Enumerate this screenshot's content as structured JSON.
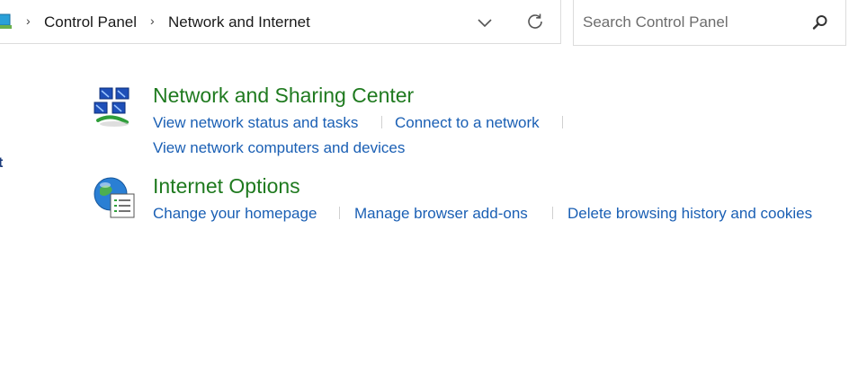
{
  "breadcrumb": {
    "items": [
      "Control Panel",
      "Network and Internet"
    ]
  },
  "search": {
    "placeholder": "Search Control Panel",
    "value": ""
  },
  "sidebar": {
    "partial_text": "t"
  },
  "categories": [
    {
      "title": "Network and Sharing Center",
      "icon": "network-icon",
      "links": [
        "View network status and tasks",
        "Connect to a network",
        "View network computers and devices"
      ]
    },
    {
      "title": "Internet Options",
      "icon": "internet-options-icon",
      "links": [
        "Change your homepage",
        "Manage browser add-ons",
        "Delete browsing history and cookies"
      ]
    }
  ],
  "colors": {
    "title_green": "#1f7a1f",
    "link_blue": "#1a5fb4",
    "border": "#dcdcdc"
  }
}
